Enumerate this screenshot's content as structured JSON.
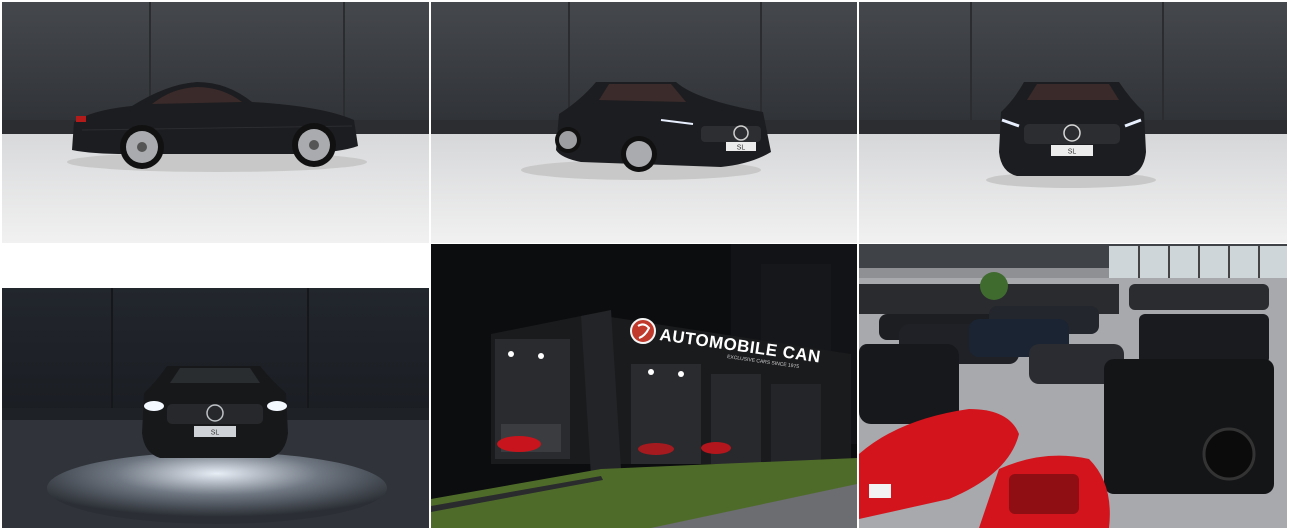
{
  "gallery": {
    "tiles": [
      {
        "name": "sl-side-view",
        "plate": ""
      },
      {
        "name": "sl-three-quarter-front",
        "plate": "SL"
      },
      {
        "name": "sl-front-view",
        "plate": "SL"
      },
      {
        "name": "sl-front-dark",
        "plate": "SL"
      },
      {
        "name": "dealership-night"
      },
      {
        "name": "showroom-interior"
      }
    ],
    "dealership_sign": "AUTOMOBILE CAN",
    "dealership_tagline": "EXCLUSIVE CARS SINCE 1975"
  },
  "colors": {
    "studio_wall": "#3c3f44",
    "studio_floor": "#e4e4e4",
    "car_body": "#1b1c1e",
    "sign_glow": "#ffffff",
    "ferrari_red": "#d4141c"
  }
}
